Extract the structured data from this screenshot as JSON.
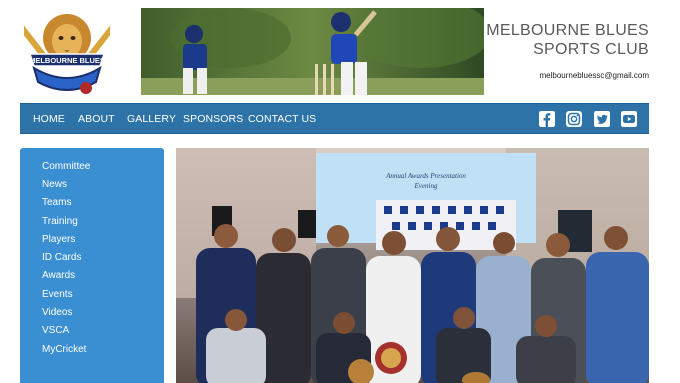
{
  "header": {
    "logo_text": "MELBOURNE BLUES",
    "title_line1": "MELBOURNE BLUES",
    "title_line2": "SPORTS CLUB",
    "email": "melbournebluessc@gmail.com"
  },
  "nav": {
    "items": [
      {
        "label": "HOME"
      },
      {
        "label": "ABOUT"
      },
      {
        "label": "GALLERY"
      },
      {
        "label": "SPONSORS"
      },
      {
        "label": "CONTACT US"
      }
    ],
    "social": [
      "facebook-icon",
      "instagram-icon",
      "twitter-icon",
      "youtube-icon"
    ]
  },
  "sidebar": {
    "items": [
      {
        "label": "Committee"
      },
      {
        "label": "News"
      },
      {
        "label": "Teams"
      },
      {
        "label": "Training"
      },
      {
        "label": "Players"
      },
      {
        "label": "ID Cards"
      },
      {
        "label": "Awards"
      },
      {
        "label": "Events"
      },
      {
        "label": "Videos"
      },
      {
        "label": "VSCA"
      },
      {
        "label": "MyCricket"
      }
    ]
  },
  "photo": {
    "screen_line1": "Annual Awards Presentation",
    "screen_line2": "Evening"
  },
  "colors": {
    "nav_bg": "#2d73a8",
    "sidebar_bg": "#3a8fd3",
    "brand_navy": "#1c2f6e",
    "brand_gold": "#d9a43a"
  }
}
